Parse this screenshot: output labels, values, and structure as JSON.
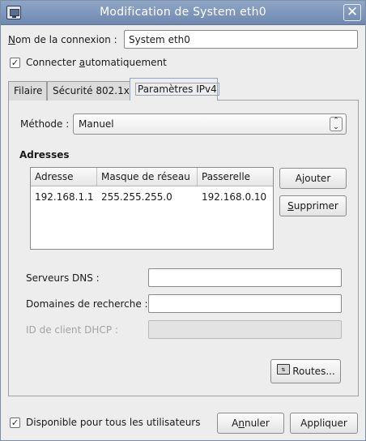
{
  "window": {
    "title": "Modification de System eth0",
    "title_icon": "network-connection-icon",
    "close_glyph": "✕"
  },
  "connection": {
    "name_label_prefix": "N",
    "name_label_rest": "om de la connexion :",
    "name_value": "System eth0",
    "auto_connect_checked": true,
    "auto_connect_label_a": "Connecter ",
    "auto_connect_label_u": "a",
    "auto_connect_label_b": "utomatiquement"
  },
  "tabs": [
    {
      "label": "Filaire",
      "active": false
    },
    {
      "label": "Sécurité 802.1x",
      "active": false
    },
    {
      "label": "Paramètres IPv4",
      "active": true
    }
  ],
  "ipv4": {
    "method_label": "Méthode :",
    "method_value": "Manuel",
    "addresses_heading": "Adresses",
    "columns": [
      "Adresse",
      "Masque de réseau",
      "Passerelle"
    ],
    "rows": [
      [
        "192.168.1.1",
        "255.255.255.0",
        "192.168.0.10"
      ]
    ],
    "add_button": "Ajouter",
    "delete_button_u": "S",
    "delete_button_rest": "upprimer",
    "dns_label": "Serveurs DNS :",
    "dns_value": "",
    "search_domains_label": "Domaines de recherche :",
    "search_domains_value": "",
    "dhcp_client_id_label": "ID de client DHCP :",
    "dhcp_client_id_value": "",
    "routes_button": "Routes..."
  },
  "footer": {
    "available_all_users_checked": true,
    "available_all_users_label": "Disponible pour tous les utilisateurs",
    "cancel_prefix": "A",
    "cancel_u": "n",
    "cancel_rest": "nuler",
    "apply_button": "Appliquer"
  }
}
